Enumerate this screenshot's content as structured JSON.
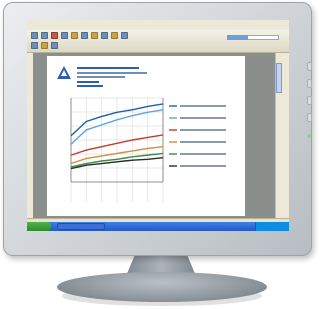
{
  "monitor": {
    "bezel_color": "#d6dadd",
    "stand_color": "#9aa2a9"
  },
  "browser": {
    "toolbar_icons": [
      "back-icon",
      "forward-icon",
      "stop-icon",
      "refresh-icon",
      "home-icon",
      "search-icon",
      "favorites-icon",
      "history-icon",
      "mail-icon",
      "print-icon"
    ],
    "progress": 0.4
  },
  "document": {
    "logo_icon": "logo-a-icon",
    "accent_color": "#2f5fb0"
  },
  "chart_data": {
    "type": "line",
    "grid": true,
    "series": [
      {
        "color": "#1f5fb0",
        "values": [
          0.55,
          0.72,
          0.78,
          0.83,
          0.86,
          0.9,
          0.93
        ]
      },
      {
        "color": "#5aa6d8",
        "values": [
          0.45,
          0.62,
          0.68,
          0.74,
          0.79,
          0.83,
          0.86
        ]
      },
      {
        "color": "#c23c2e",
        "values": [
          0.32,
          0.38,
          0.42,
          0.46,
          0.5,
          0.53,
          0.56
        ]
      },
      {
        "color": "#d98a3a",
        "values": [
          0.22,
          0.28,
          0.31,
          0.34,
          0.37,
          0.4,
          0.42
        ]
      },
      {
        "color": "#3e8a3e",
        "values": [
          0.18,
          0.22,
          0.25,
          0.27,
          0.3,
          0.32,
          0.34
        ]
      },
      {
        "color": "#2a2a2a",
        "values": [
          0.16,
          0.2,
          0.22,
          0.24,
          0.26,
          0.27,
          0.29
        ]
      }
    ]
  },
  "taskbar": {
    "start_icon": "windows-start-icon",
    "tray_icon": "clock-icon"
  }
}
